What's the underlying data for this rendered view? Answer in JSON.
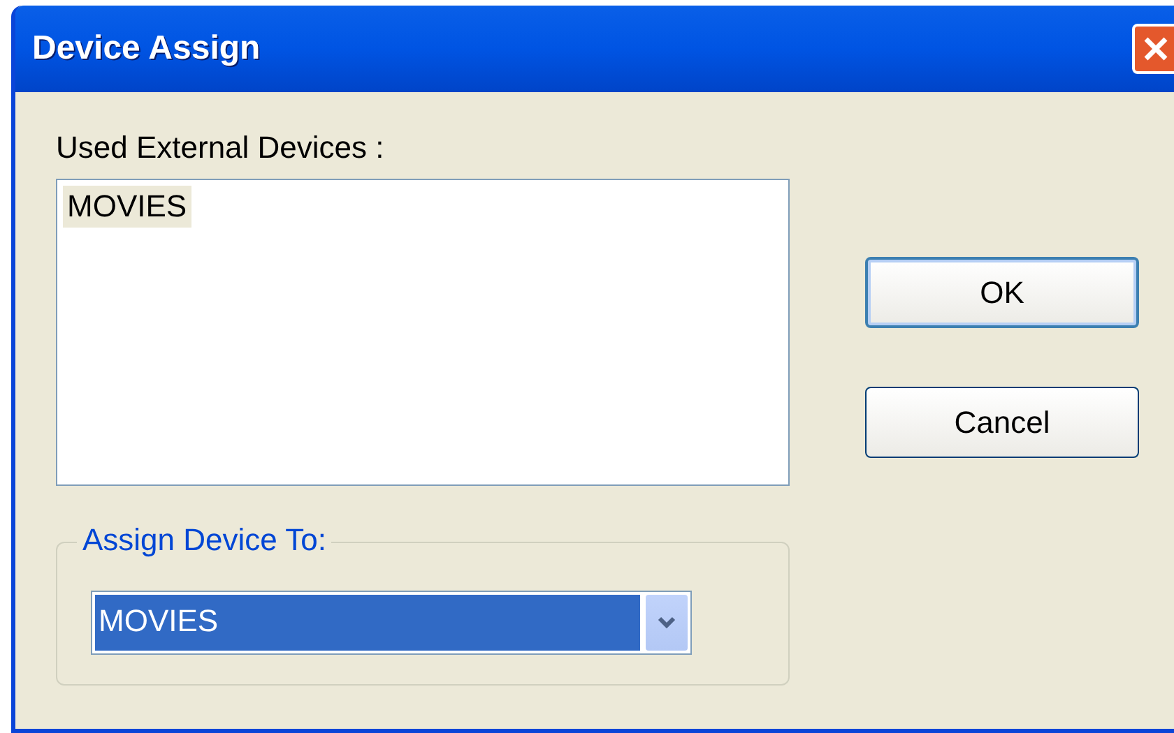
{
  "window": {
    "title": "Device Assign"
  },
  "devices_label": "Used External Devices :",
  "devices": [
    {
      "name": "MOVIES",
      "selected": true
    }
  ],
  "assign_group": {
    "title": "Assign Device To:",
    "value": "MOVIES"
  },
  "buttons": [
    {
      "label": "OK",
      "default": true
    },
    {
      "label": "Cancel",
      "default": false
    }
  ]
}
